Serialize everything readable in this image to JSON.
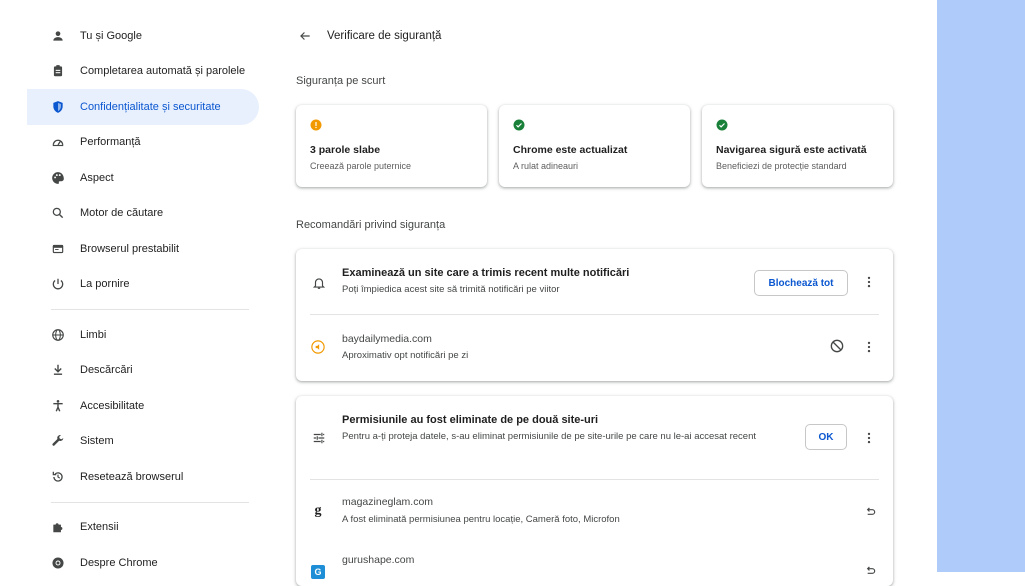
{
  "sidebar": {
    "items": [
      {
        "label": "Tu și Google",
        "icon": "person-icon"
      },
      {
        "label": "Completarea automată și parolele",
        "icon": "clipboard-icon"
      },
      {
        "label": "Confidențialitate și securitate",
        "icon": "shield-icon"
      },
      {
        "label": "Performanță",
        "icon": "speedometer-icon"
      },
      {
        "label": "Aspect",
        "icon": "palette-icon"
      },
      {
        "label": "Motor de căutare",
        "icon": "search-icon"
      },
      {
        "label": "Browserul prestabilit",
        "icon": "browser-icon"
      },
      {
        "label": "La pornire",
        "icon": "power-icon"
      },
      {
        "label": "Limbi",
        "icon": "globe-icon"
      },
      {
        "label": "Descărcări",
        "icon": "download-icon"
      },
      {
        "label": "Accesibilitate",
        "icon": "accessibility-icon"
      },
      {
        "label": "Sistem",
        "icon": "wrench-icon"
      },
      {
        "label": "Resetează browserul",
        "icon": "reset-icon"
      },
      {
        "label": "Extensii",
        "icon": "puzzle-icon"
      },
      {
        "label": "Despre Chrome",
        "icon": "chrome-icon"
      }
    ]
  },
  "header": {
    "title": "Verificare de siguranță"
  },
  "summary": {
    "label": "Siguranța pe scurt",
    "cards": [
      {
        "title": "3 parole slabe",
        "subtitle": "Creează parole puternice",
        "status": "warning",
        "color": "#f29900"
      },
      {
        "title": "Chrome este actualizat",
        "subtitle": "A rulat adineauri",
        "status": "ok",
        "color": "#188038"
      },
      {
        "title": "Navigarea sigură este activată",
        "subtitle": "Beneficiezi de protecție standard",
        "status": "ok",
        "color": "#188038"
      }
    ]
  },
  "recommendations": {
    "label": "Recomandări privind siguranța",
    "notifications": {
      "title": "Examinează un site care a trimis recent multe notificări",
      "description": "Poți împiedica acest site să trimită notificări pe viitor",
      "button": "Blochează tot",
      "site": {
        "name": "baydailymedia.com",
        "detail": "Aproximativ opt notificări pe zi"
      }
    },
    "permissions": {
      "title": "Permisiunile au fost eliminate de pe două site-uri",
      "description": "Pentru a-ți proteja datele, s-au eliminat permisiunile de pe site-urile pe care nu le-ai accesat recent",
      "button": "OK",
      "sites": [
        {
          "name": "magazineglam.com",
          "detail": "A fost eliminată permisiunea pentru locație, Cameră foto, Microfon",
          "favicon": "g"
        },
        {
          "name": "gurushape.com",
          "favicon": "G"
        }
      ]
    }
  },
  "colors": {
    "accent": "#0b57d0",
    "active_bg": "#e8f0fe",
    "side_bg": "#aecbfa"
  }
}
